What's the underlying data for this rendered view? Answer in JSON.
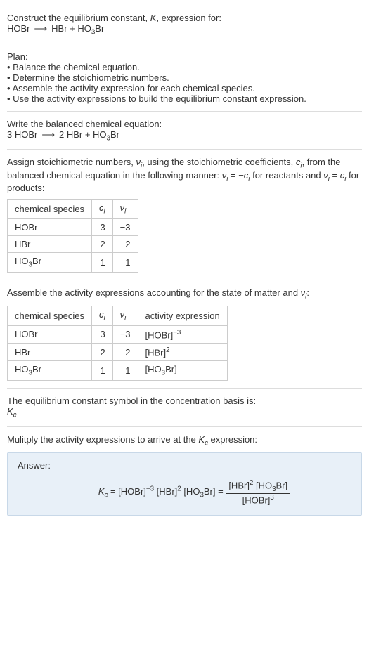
{
  "section1": {
    "line1": "Construct the equilibrium constant, K, expression for:",
    "equation": "HOBr  ⟶  HBr + HO₃Br"
  },
  "plan": {
    "heading": "Plan:",
    "items": [
      "• Balance the chemical equation.",
      "• Determine the stoichiometric numbers.",
      "• Assemble the activity expression for each chemical species.",
      "• Use the activity expressions to build the equilibrium constant expression."
    ]
  },
  "balanced": {
    "line1": "Write the balanced chemical equation:",
    "equation": "3 HOBr  ⟶  2 HBr + HO₃Br"
  },
  "stoich": {
    "intro": "Assign stoichiometric numbers, νᵢ, using the stoichiometric coefficients, cᵢ, from the balanced chemical equation in the following manner: νᵢ = −cᵢ for reactants and νᵢ = cᵢ for products:",
    "headers": [
      "chemical species",
      "cᵢ",
      "νᵢ"
    ],
    "rows": [
      [
        "HOBr",
        "3",
        "−3"
      ],
      [
        "HBr",
        "2",
        "2"
      ],
      [
        "HO₃Br",
        "1",
        "1"
      ]
    ]
  },
  "activity": {
    "intro": "Assemble the activity expressions accounting for the state of matter and νᵢ:",
    "headers": [
      "chemical species",
      "cᵢ",
      "νᵢ",
      "activity expression"
    ],
    "rows": [
      {
        "species": "HOBr",
        "c": "3",
        "v": "−3",
        "expr_base": "[HOBr]",
        "expr_exp": "−3"
      },
      {
        "species": "HBr",
        "c": "2",
        "v": "2",
        "expr_base": "[HBr]",
        "expr_exp": "2"
      },
      {
        "species": "HO₃Br",
        "c": "1",
        "v": "1",
        "expr_base": "[HO₃Br]",
        "expr_exp": ""
      }
    ]
  },
  "symbol": {
    "line1": "The equilibrium constant symbol in the concentration basis is:",
    "line2": "K_c"
  },
  "multiply": {
    "line1": "Mulitply the activity expressions to arrive at the Kc expression:"
  },
  "answer": {
    "label": "Answer:",
    "lhs": "Kc = [HOBr]⁻³ [HBr]² [HO₃Br] =",
    "frac_num": "[HBr]² [HO₃Br]",
    "frac_den": "[HOBr]³"
  },
  "chart_data": {
    "type": "table",
    "tables": [
      {
        "title": "Stoichiometric numbers",
        "columns": [
          "chemical species",
          "c_i",
          "ν_i"
        ],
        "rows": [
          [
            "HOBr",
            3,
            -3
          ],
          [
            "HBr",
            2,
            2
          ],
          [
            "HO3Br",
            1,
            1
          ]
        ]
      },
      {
        "title": "Activity expressions",
        "columns": [
          "chemical species",
          "c_i",
          "ν_i",
          "activity expression"
        ],
        "rows": [
          [
            "HOBr",
            3,
            -3,
            "[HOBr]^-3"
          ],
          [
            "HBr",
            2,
            2,
            "[HBr]^2"
          ],
          [
            "HO3Br",
            1,
            1,
            "[HO3Br]"
          ]
        ]
      }
    ]
  }
}
